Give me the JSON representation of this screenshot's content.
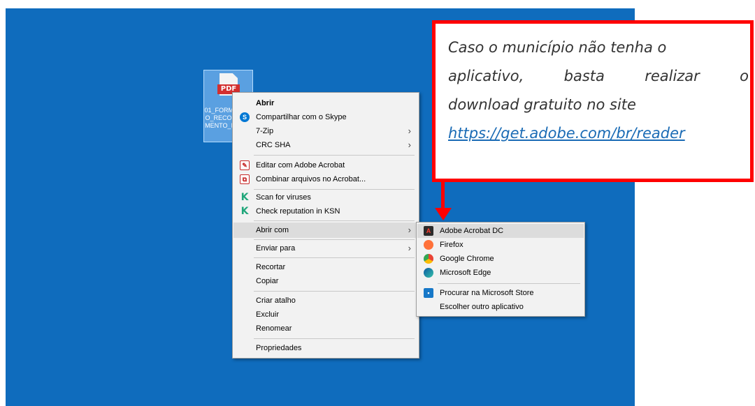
{
  "file": {
    "badge": "PDF",
    "name": "01_FORMULARIO_RECONHECIMENTO_ICIPAC"
  },
  "context_menu": {
    "open": "Abrir",
    "share_skype": "Compartilhar com o Skype",
    "zip": "7-Zip",
    "crc": "CRC SHA",
    "edit_acrobat": "Editar com Adobe Acrobat",
    "combine_acrobat": "Combinar arquivos no Acrobat...",
    "scan_viruses": "Scan for viruses",
    "check_reputation": "Check reputation in KSN",
    "open_with": "Abrir com",
    "send_to": "Enviar para",
    "cut": "Recortar",
    "copy": "Copiar",
    "create_shortcut": "Criar atalho",
    "delete": "Excluir",
    "rename": "Renomear",
    "properties": "Propriedades"
  },
  "open_with_menu": {
    "acrobat": "Adobe Acrobat DC",
    "firefox": "Firefox",
    "chrome": "Google Chrome",
    "edge": "Microsoft Edge",
    "store": "Procurar na Microsoft Store",
    "other": "Escolher outro aplicativo"
  },
  "callout": {
    "line1": "Caso o município não tenha o",
    "line2_words": [
      "aplicativo,",
      "basta",
      "realizar",
      "o"
    ],
    "line3": "download gratuito no site",
    "link": "https://get.adobe.com/br/reader"
  },
  "colors": {
    "desktop": "#0f6cbd",
    "callout_border": "#ff0000",
    "link": "#1a6bb5"
  },
  "icons": {
    "skype": "skype-icon",
    "acrobat_edit": "acrobat-edit-icon",
    "acrobat_combine": "acrobat-combine-icon",
    "kaspersky": "kaspersky-k-icon",
    "acrobat_dc": "acrobat-dc-icon",
    "firefox": "firefox-icon",
    "chrome": "chrome-icon",
    "edge": "edge-icon",
    "store": "store-icon",
    "submenu": "chevron-right-icon"
  }
}
